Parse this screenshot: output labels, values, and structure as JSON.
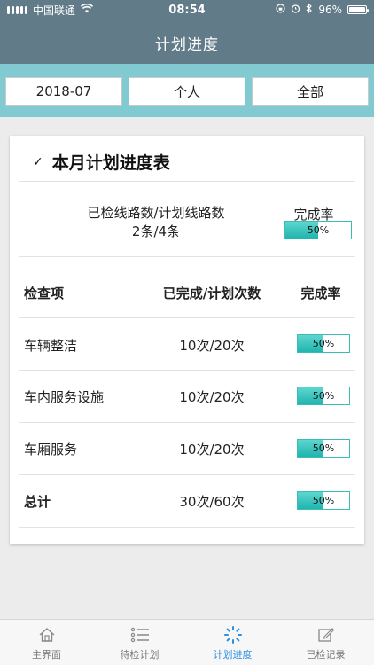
{
  "status_bar": {
    "carrier": "中国联通",
    "time": "08:54",
    "battery": "96%"
  },
  "header": {
    "title": "计划进度"
  },
  "filters": {
    "month": "2018-07",
    "scope": "个人",
    "category": "全部"
  },
  "card": {
    "title": "本月计划进度表",
    "summary": {
      "label_line1": "已检线路数/计划线路数",
      "label_line2": "2条/4条",
      "rate_header": "完成率",
      "rate_text": "50%",
      "rate_value": 0.5
    },
    "table": {
      "headers": [
        "检查项",
        "已完成/计划次数",
        "完成率"
      ],
      "rows": [
        {
          "item": "车辆整洁",
          "count": "10次/20次",
          "rate_text": "50%",
          "rate_value": 0.5
        },
        {
          "item": "车内服务设施",
          "count": "10次/20次",
          "rate_text": "50%",
          "rate_value": 0.5
        },
        {
          "item": "车厢服务",
          "count": "10次/20次",
          "rate_text": "50%",
          "rate_value": 0.5
        }
      ],
      "total": {
        "item": "总计",
        "count": "30次/60次",
        "rate_text": "50%",
        "rate_value": 0.5
      }
    }
  },
  "tabbar": {
    "tabs": [
      {
        "label": "主界面",
        "icon": "home-icon"
      },
      {
        "label": "待检计划",
        "icon": "list-icon"
      },
      {
        "label": "计划进度",
        "icon": "progress-spinner-icon",
        "active": true
      },
      {
        "label": "已检记录",
        "icon": "edit-record-icon"
      }
    ]
  },
  "colors": {
    "header_bg": "#627b89",
    "filter_bar_bg": "#82cad1",
    "progress_fill": "#1fb5ae",
    "active_tab": "#2d8fe0"
  }
}
